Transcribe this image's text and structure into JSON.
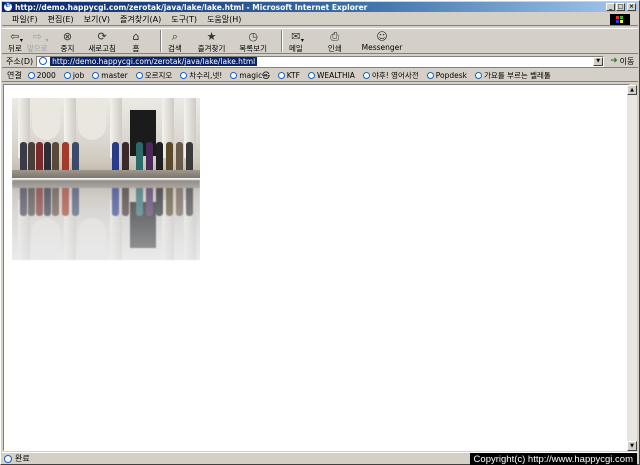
{
  "window": {
    "title": "http://demo.happycgi.com/zerotak/java/lake/lake.html - Microsoft Internet Explorer",
    "minimize": "_",
    "maximize": "□",
    "close": "×"
  },
  "menu": {
    "items": [
      "파일(F)",
      "편집(E)",
      "보기(V)",
      "즐겨찾기(A)",
      "도구(T)",
      "도움말(H)"
    ]
  },
  "toolbar": {
    "back": "뒤로",
    "forward": "앞으로",
    "stop": "중지",
    "refresh": "새로고침",
    "home": "홈",
    "search": "검색",
    "favorites": "즐겨찾기",
    "history": "목록보기",
    "mail": "메일",
    "print": "인쇄",
    "messenger": "Messenger"
  },
  "address": {
    "label": "주소(D)",
    "url": "http://demo.happycgi.com/zerotak/java/lake/lake.html",
    "go": "이동"
  },
  "links": {
    "label": "연결",
    "items": [
      "2000",
      "job",
      "master",
      "오르지오",
      "차수리,넷!",
      "magic㉿",
      "KTF",
      "WEALTHIA",
      "야후! 영어사전",
      "Popdesk",
      "가요를 부르는 벨레톨"
    ]
  },
  "status": {
    "text": "완료",
    "overlay": "Copyright(c) http://www.happycgi.com"
  },
  "colors": {
    "titlebar_start": "#0a246a",
    "titlebar_end": "#a6caf0",
    "chrome": "#d4d0c8"
  }
}
